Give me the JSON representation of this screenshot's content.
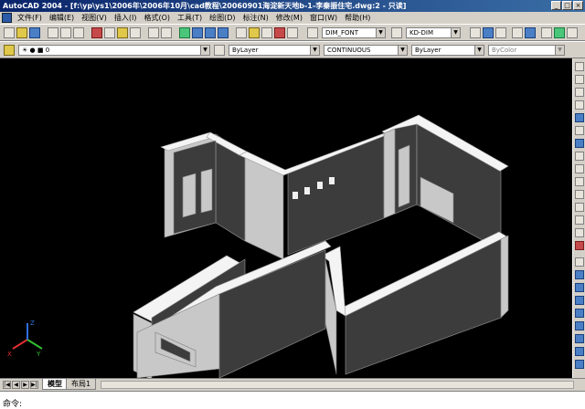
{
  "title": "AutoCAD 2004 - [f:\\yp\\ys1\\2006年\\2006年10月\\cad教程\\20060901海淀新天地b-1-李秦振住宅.dwg:2 - 只读]",
  "window_buttons": [
    "_",
    "□",
    "×"
  ],
  "menu": [
    "文件(F)",
    "编辑(E)",
    "视图(V)",
    "插入(I)",
    "格式(O)",
    "工具(T)",
    "绘图(D)",
    "标注(N)",
    "修改(M)",
    "窗口(W)",
    "帮助(H)"
  ],
  "toolbar": {
    "textstyle": "DIM_FONT",
    "dimstyle": "KD-DIM"
  },
  "layer_bar": {
    "layer": "0",
    "color": "ByLayer",
    "linetype": "CONTINUOUS",
    "lineweight": "ByLayer",
    "plotstyle": "ByColor"
  },
  "tabs": {
    "model": "模型",
    "layout1": "布局1"
  },
  "command": {
    "prompt": "命令:"
  },
  "ucs": {
    "x": "X",
    "y": "Y",
    "z": "Z"
  },
  "colors": {
    "canvas": "#000000",
    "wall_top": "#f4f4f4",
    "wall_light": "#c8c8c8",
    "wall_dark": "#3c3c3c",
    "chrome": "#d4d0c8"
  }
}
